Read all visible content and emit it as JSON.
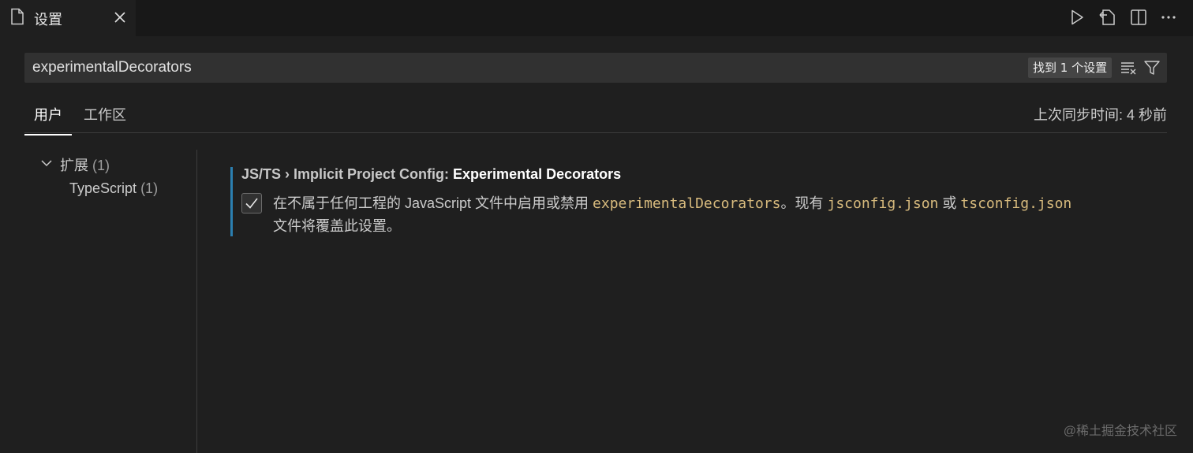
{
  "tab": {
    "title": "设置"
  },
  "toolbar": {
    "icons": [
      "run-icon",
      "open-settings-json-icon",
      "split-editor-icon",
      "more-actions-icon"
    ]
  },
  "search": {
    "value": "experimentalDecorators",
    "results_badge": "找到 1 个设置"
  },
  "scope_tabs": [
    {
      "label": "用户",
      "active": true
    },
    {
      "label": "工作区",
      "active": false
    }
  ],
  "sync_status": "上次同步时间: 4 秒前",
  "tree": {
    "group_label": "扩展",
    "group_count": "(1)",
    "child_label": "TypeScript",
    "child_count": "(1)"
  },
  "setting": {
    "category": "JS/TS › Implicit Project Config: ",
    "name": "Experimental Decorators",
    "checked": true,
    "desc_part1": "在不属于任何工程的 JavaScript 文件中启用或禁用 ",
    "code1": "experimentalDecorators",
    "desc_part2": "。现有 ",
    "code2": "jsconfig.json",
    "desc_part3": " 或 ",
    "code3": "tsconfig.json",
    "desc_part4": "文件将覆盖此设置。"
  },
  "watermark": "@稀土掘金技术社区",
  "colors": {
    "background": "#1f1f1f",
    "accent_bar": "#2b7fb0",
    "code_text": "#d7ba7d"
  }
}
